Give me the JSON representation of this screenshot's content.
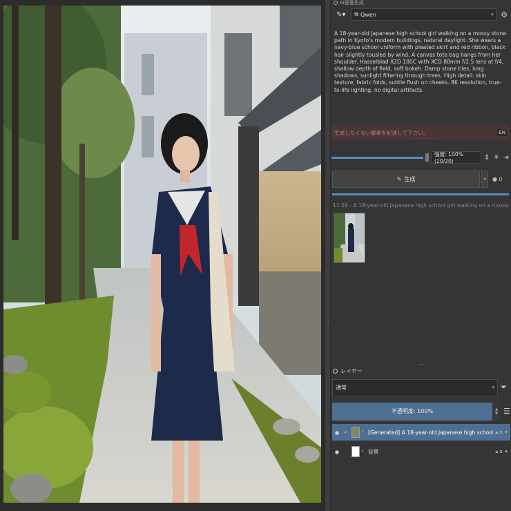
{
  "panel": {
    "title": "AI画像生成"
  },
  "model": {
    "selected": "Qwen"
  },
  "prompt": {
    "text": "A 18-year-old Japanese high school girl walking on a mossy stone path in Kyoto's modern buildings, natural daylight. She wears a navy-blue school uniform with pleated skirt and red ribbon, black hair slightly tousled by wind. A canvas tote bag hangs from her shoulder. Hasselblad X2D 100C with XCD 80mm f/2.5 lens at f/4, shallow depth of field, soft bokeh. Damp stone tiles, long shadows, sunlight filtering through trees. High detail: skin texture, fabric folds, subtle flush on cheeks. 8K resolution, true-to-life lighting, no digital artifacts."
  },
  "negative": {
    "placeholder": "生成したくない要素を記述して下さい。",
    "lang": "EN"
  },
  "strength": {
    "label": "強度: 100% (20/20)",
    "value": 1.0
  },
  "generate": {
    "label": "生成",
    "queue": "0"
  },
  "progress": 1.0,
  "history": {
    "title": "11:29 - A 18-year-old Japanese high school girl walking on a mossy stone path in Kyoto's"
  },
  "layers": {
    "title": "レイヤー",
    "blend_mode": "通常",
    "opacity_label": "不透明度: 100%",
    "items": [
      {
        "name": "[Generated] A 18-year-old Japanese high school girl walking on a ...",
        "flags": "α",
        "selected": true
      },
      {
        "name": "背景",
        "flags": "α",
        "selected": false
      }
    ]
  },
  "icons": {
    "model_tool": "magic-wand-icon",
    "settings": "gear-icon",
    "generate": "magic-wand-icon",
    "filter": "filter-icon",
    "menu": "hamburger-icon",
    "visible": "eye-icon",
    "lock": "lock-icon"
  },
  "colors": {
    "accent": "#4d6f91",
    "progress": "#5a8ac0",
    "negative_bg": "#4a3434",
    "panel_bg": "#353535"
  }
}
